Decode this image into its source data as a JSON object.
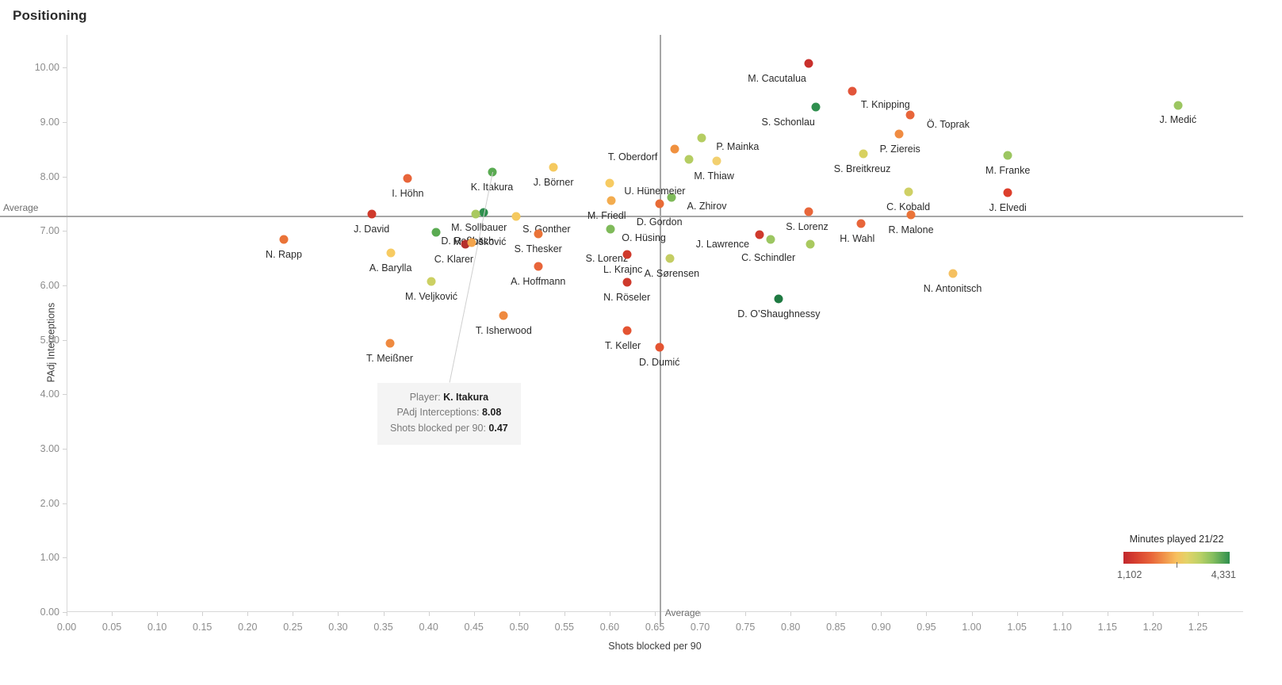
{
  "title": "Positioning",
  "axes": {
    "x_title": "Shots blocked per 90",
    "y_title": "PAdj Interceptions",
    "x_ticks": [
      "0.00",
      "0.05",
      "0.10",
      "0.15",
      "0.20",
      "0.25",
      "0.30",
      "0.35",
      "0.40",
      "0.45",
      "0.50",
      "0.55",
      "0.60",
      "0.65",
      "0.70",
      "0.75",
      "0.80",
      "0.85",
      "0.90",
      "0.95",
      "1.00",
      "1.05",
      "1.10",
      "1.15",
      "1.20",
      "1.25"
    ],
    "y_ticks": [
      "0.00",
      "1.00",
      "2.00",
      "3.00",
      "4.00",
      "5.00",
      "6.00",
      "7.00",
      "8.00",
      "9.00",
      "10.00"
    ]
  },
  "reference_lines": {
    "horizontal_label": "Average",
    "vertical_label": "Average",
    "horizontal_value": 7.28,
    "vertical_value": 0.655
  },
  "legend": {
    "title": "Minutes played 21/22",
    "min": "1,102",
    "max": "4,331",
    "colors": [
      "#c1272d",
      "#e8653a",
      "#f7c05f",
      "#bcd167",
      "#2f8f4e"
    ]
  },
  "tooltip": {
    "player_label": "Player:",
    "player_value": "K. Itakura",
    "interceptions_label": "PAdj Interceptions:",
    "interceptions_value": "8.08",
    "shots_label": "Shots blocked per 90:",
    "shots_value": "0.47"
  },
  "chart_data": {
    "type": "scatter",
    "title": "Positioning",
    "xlabel": "Shots blocked per 90",
    "ylabel": "PAdj Interceptions",
    "xlim": [
      0.0,
      1.3
    ],
    "ylim": [
      0.0,
      10.6
    ],
    "grid": false,
    "legend_position": "bottom-right",
    "color_scale": {
      "label": "Minutes played 21/22",
      "min": 1102,
      "max": 4331
    },
    "points": [
      {
        "name": "M. Cacutalua",
        "x": 0.82,
        "y": 10.08,
        "color": "#c9302c",
        "label_dx": -40,
        "label_dy": 12
      },
      {
        "name": "T. Knipping",
        "x": 0.868,
        "y": 9.57,
        "color": "#e2553a",
        "label_dx": 42,
        "label_dy": 10
      },
      {
        "name": "S. Schonlau",
        "x": 0.828,
        "y": 9.27,
        "color": "#2f8f4e",
        "label_dx": -35,
        "label_dy": 12
      },
      {
        "name": "J. Medić",
        "x": 1.228,
        "y": 9.3,
        "color": "#9cc661",
        "label_dx": 0,
        "label_dy": 11
      },
      {
        "name": "Ö. Toprak",
        "x": 0.932,
        "y": 9.13,
        "color": "#e8653a",
        "label_dx": 48,
        "label_dy": 5
      },
      {
        "name": "P. Ziereis",
        "x": 0.92,
        "y": 8.78,
        "color": "#f08c42",
        "label_dx": 1,
        "label_dy": 12
      },
      {
        "name": "P. Mainka",
        "x": 0.702,
        "y": 8.7,
        "color": "#b5cd62",
        "label_dx": 45,
        "label_dy": 4
      },
      {
        "name": "T. Oberdorf",
        "x": 0.672,
        "y": 8.5,
        "color": "#f0913f",
        "label_dx": -53,
        "label_dy": 3
      },
      {
        "name": "S. Breitkreuz",
        "x": 0.88,
        "y": 8.42,
        "color": "#d8d160",
        "label_dx": -1,
        "label_dy": 12
      },
      {
        "name": "M. Franke",
        "x": 1.04,
        "y": 8.39,
        "color": "#9cc661",
        "label_dx": 0,
        "label_dy": 12
      },
      {
        "name": "M. Thiaw",
        "x": 0.718,
        "y": 8.29,
        "color": "#f2d070",
        "label_dx": -3,
        "label_dy": 12
      },
      {
        "name": "S. Lorenz",
        "x": 0.688,
        "y": 8.32,
        "color": "#b5cd62",
        "label_dx": -104,
        "label_dy": 118
      },
      {
        "name": "J. Börner",
        "x": 0.538,
        "y": 8.17,
        "color": "#f5c95f",
        "label_dx": 0,
        "label_dy": 12
      },
      {
        "name": "K. Itakura",
        "x": 0.47,
        "y": 8.08,
        "color": "#5aab52",
        "label_dx": 0,
        "label_dy": 12
      },
      {
        "name": "I. Höhn",
        "x": 0.377,
        "y": 7.96,
        "color": "#e8653a",
        "label_dx": 0,
        "label_dy": 12
      },
      {
        "name": "J. Elvedi",
        "x": 1.04,
        "y": 7.7,
        "color": "#dd3f2c",
        "label_dx": 0,
        "label_dy": 12
      },
      {
        "name": "C. Kobald",
        "x": 0.93,
        "y": 7.72,
        "color": "#cfd065",
        "label_dx": 0,
        "label_dy": 12
      },
      {
        "name": "A. Zhirov",
        "x": 0.668,
        "y": 7.61,
        "color": "#7fba5a",
        "label_dx": 45,
        "label_dy": 4
      },
      {
        "name": "U. Hünemeier",
        "x": 0.6,
        "y": 7.87,
        "color": "#f7cb62",
        "label_dx": 57,
        "label_dy": 3
      },
      {
        "name": "M. Friedl",
        "x": 0.602,
        "y": 7.55,
        "color": "#f3ac4f",
        "label_dx": -6,
        "label_dy": 12
      },
      {
        "name": "D. Gordon",
        "x": 0.655,
        "y": 7.5,
        "color": "#e86b36",
        "label_dx": 0,
        "label_dy": 16
      },
      {
        "name": "M. Sollbauer",
        "x": 0.461,
        "y": 7.34,
        "color": "#2f8f4e",
        "label_dx": -6,
        "label_dy": 12
      },
      {
        "name": "S. Gonther",
        "x": 0.497,
        "y": 7.26,
        "color": "#f5c95f",
        "label_dx": 38,
        "label_dy": 9
      },
      {
        "name": "M. Vušković",
        "x": 0.452,
        "y": 7.31,
        "color": "#a9c95f",
        "label_dx": 5,
        "label_dy": 28
      },
      {
        "name": "S. Lorenz2",
        "x": 0.82,
        "y": 7.35,
        "color": "#e8663a",
        "label_dx": -2,
        "label_dy": 12,
        "label": "S. Lorenz"
      },
      {
        "name": "J. David",
        "x": 0.337,
        "y": 7.31,
        "color": "#cf3a2c",
        "label_dx": 0,
        "label_dy": 12
      },
      {
        "name": "R. Malone",
        "x": 0.933,
        "y": 7.3,
        "color": "#ea7338",
        "label_dx": 0,
        "label_dy": 12
      },
      {
        "name": "H. Wahl",
        "x": 0.878,
        "y": 7.14,
        "color": "#e8653a",
        "label_dx": -5,
        "label_dy": 12
      },
      {
        "name": "D. Roßbach",
        "x": 0.408,
        "y": 6.97,
        "color": "#5aab52",
        "label_dx": 40,
        "label_dy": 4
      },
      {
        "name": "S. Thesker",
        "x": 0.521,
        "y": 6.94,
        "color": "#ea7338",
        "label_dx": 0,
        "label_dy": 12
      },
      {
        "name": "J. Lawrence",
        "x": 0.766,
        "y": 6.93,
        "color": "#cf3a2c",
        "label_dx": -47,
        "label_dy": 5
      },
      {
        "name": "C. Schindler",
        "x": 0.778,
        "y": 6.85,
        "color": "#9cc661",
        "label_dx": -3,
        "label_dy": 16
      },
      {
        "name": "N. Rapp",
        "x": 0.24,
        "y": 6.85,
        "color": "#ea7338",
        "label_dx": 0,
        "label_dy": 12
      },
      {
        "name": "C. Klarer",
        "x": 0.441,
        "y": 6.76,
        "color": "#b5302c",
        "label_dx": -15,
        "label_dy": 12
      },
      {
        "name": "S. Lorenz3",
        "x": 0.822,
        "y": 6.76,
        "color": "#a9c95f",
        "label_dx": 0,
        "label_dy": 0,
        "label": ""
      },
      {
        "name": "M. Vuskovic2",
        "x": 0.448,
        "y": 6.79,
        "color": "#f3a44c",
        "label_dx": 0,
        "label_dy": 0,
        "label": ""
      },
      {
        "name": "O. Hüsing",
        "x": 0.601,
        "y": 7.03,
        "color": "#7fba5a",
        "label_dx": 42,
        "label_dy": 4
      },
      {
        "name": "A. Barylla",
        "x": 0.358,
        "y": 6.59,
        "color": "#f7cb62",
        "label_dx": 0,
        "label_dy": 12
      },
      {
        "name": "L. Krajnc",
        "x": 0.619,
        "y": 6.56,
        "color": "#cf3a2c",
        "label_dx": -5,
        "label_dy": 12
      },
      {
        "name": "A. Sørensen",
        "x": 0.667,
        "y": 6.49,
        "color": "#c4cd63",
        "label_dx": 2,
        "label_dy": 12
      },
      {
        "name": "A. Hoffmann",
        "x": 0.521,
        "y": 6.35,
        "color": "#e8653a",
        "label_dx": 0,
        "label_dy": 12
      },
      {
        "name": "N. Antonitsch",
        "x": 0.979,
        "y": 6.22,
        "color": "#f5c060",
        "label_dx": 0,
        "label_dy": 12
      },
      {
        "name": "M. Veljković",
        "x": 0.403,
        "y": 6.07,
        "color": "#ccd063",
        "label_dx": 0,
        "label_dy": 12
      },
      {
        "name": "N. Röseler",
        "x": 0.619,
        "y": 6.05,
        "color": "#cf3a2c",
        "label_dx": 0,
        "label_dy": 12
      },
      {
        "name": "D. O’Shaughnessy",
        "x": 0.787,
        "y": 5.75,
        "color": "#1f7a42",
        "label_dx": 0,
        "label_dy": 12
      },
      {
        "name": "T. Isherwood",
        "x": 0.483,
        "y": 5.44,
        "color": "#ef8a40",
        "label_dx": 0,
        "label_dy": 12
      },
      {
        "name": "T. Keller",
        "x": 0.619,
        "y": 5.17,
        "color": "#e45432",
        "label_dx": -5,
        "label_dy": 12
      },
      {
        "name": "T. Meißner",
        "x": 0.357,
        "y": 4.94,
        "color": "#ef8a40",
        "label_dx": 0,
        "label_dy": 12
      },
      {
        "name": "D. Dumić",
        "x": 0.655,
        "y": 4.86,
        "color": "#e45432",
        "label_dx": 0,
        "label_dy": 12
      }
    ]
  }
}
